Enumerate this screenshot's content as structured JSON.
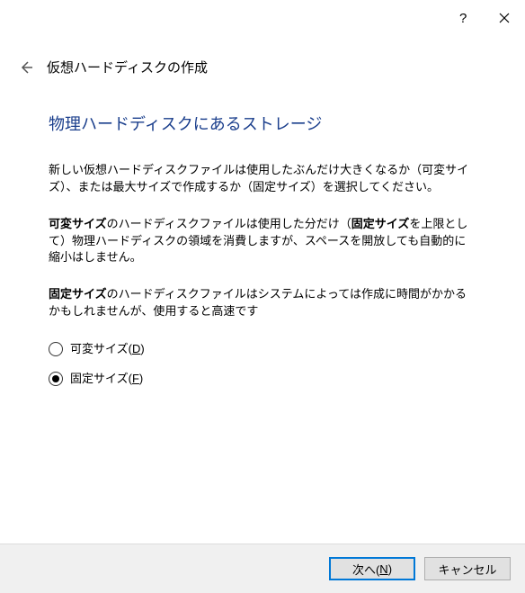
{
  "titlebar": {
    "help_tooltip": "?",
    "close_tooltip": "閉じる"
  },
  "header": {
    "title": "仮想ハードディスクの作成"
  },
  "section": {
    "title": "物理ハードディスクにあるストレージ"
  },
  "paragraphs": {
    "intro": "新しい仮想ハードディスクファイルは使用したぶんだけ大きくなるか（可変サイズ）、または最大サイズで作成するか（固定サイズ）を選択してください。",
    "dynamic_label": "可変サイズ",
    "dynamic_mid": "のハードディスクファイルは使用した分だけ（",
    "dynamic_bold2": "固定サイズ",
    "dynamic_rest": "を上限として）物理ハードディスクの領域を消費しますが、スペースを開放しても自動的に縮小はしません。",
    "fixed_label": "固定サイズ",
    "fixed_rest": "のハードディスクファイルはシステムによっては作成に時間がかかるかもしれませんが、使用すると高速です"
  },
  "options": {
    "dynamic": {
      "label": "可変サイズ(",
      "mnemonic": "D",
      "suffix": ")",
      "selected": false
    },
    "fixed": {
      "label": "固定サイズ(",
      "mnemonic": "F",
      "suffix": ")",
      "selected": true
    }
  },
  "footer": {
    "next_pre": "次へ(",
    "next_mnemonic": "N",
    "next_suf": ")",
    "cancel": "キャンセル"
  }
}
